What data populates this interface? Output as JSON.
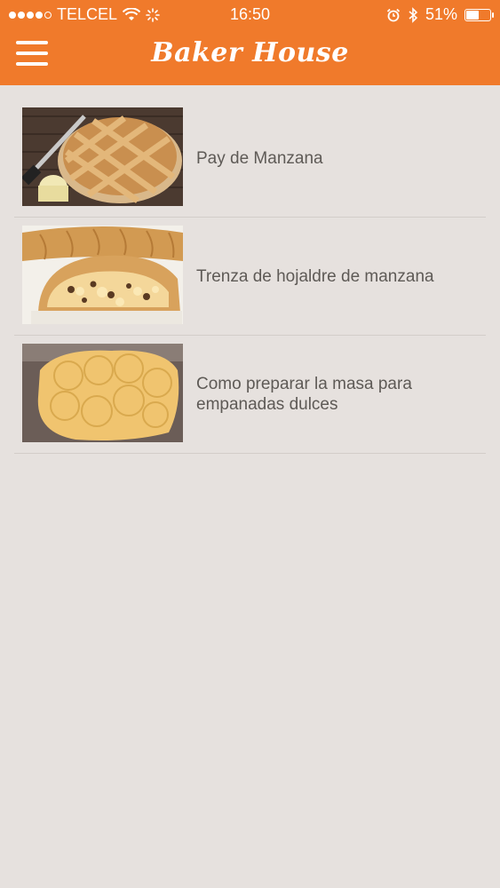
{
  "status_bar": {
    "carrier": "TELCEL",
    "time": "16:50",
    "battery": "51%",
    "battery_level": 0.51
  },
  "header": {
    "title": "Baker House"
  },
  "recipes": [
    {
      "label": "Pay de Manzana",
      "image": "apple-pie"
    },
    {
      "label": "Trenza de hojaldre de manzana",
      "image": "apple-puff-pastry-braid"
    },
    {
      "label": "Como preparar la masa para empanadas dulces",
      "image": "empanada-dough-circles"
    }
  ],
  "colors": {
    "header": "#f07a2b",
    "background": "#e6e1de",
    "label_text": "#5e5a56"
  }
}
